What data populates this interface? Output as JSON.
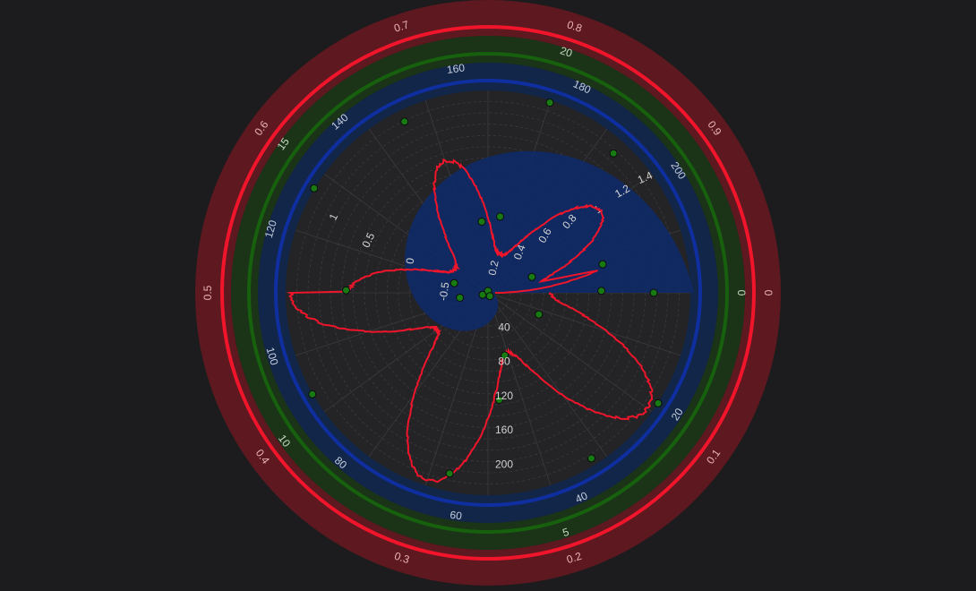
{
  "chart_data": {
    "type": "polar",
    "colors": {
      "background": "#1c1c1e",
      "plot_background": "#242427",
      "ring_outer": "#5e1820",
      "ring_middle": "#1b3418",
      "ring_inner": "#112648",
      "ring_red_line": "#f0152a",
      "ring_green_line": "#16600e",
      "ring_blue_line": "#0f2fa0",
      "spiral_fill": "#0f2a6a",
      "series_line": "#f0152a",
      "scatter": "#177a12",
      "grid": "#3b3b3f"
    },
    "outer_axis": {
      "ticks": [
        {
          "value": 0,
          "label": "0"
        },
        {
          "value": 0.1,
          "label": "0.1"
        },
        {
          "value": 0.2,
          "label": "0.2"
        },
        {
          "value": 0.3,
          "label": "0.3"
        },
        {
          "value": 0.4,
          "label": "0.4"
        },
        {
          "value": 0.5,
          "label": "0.5"
        },
        {
          "value": 0.6,
          "label": "0.6"
        },
        {
          "value": 0.7,
          "label": "0.7"
        },
        {
          "value": 0.8,
          "label": "0.8"
        },
        {
          "value": 0.9,
          "label": "0.9"
        }
      ],
      "range": [
        0,
        1
      ]
    },
    "middle_axis": {
      "ticks": [
        {
          "value": 0,
          "label": "0"
        },
        {
          "value": 5,
          "label": "5"
        },
        {
          "value": 10,
          "label": "10"
        },
        {
          "value": 15,
          "label": "15"
        },
        {
          "value": 20,
          "label": "20"
        }
      ],
      "range": [
        0,
        25
      ]
    },
    "inner_axis": {
      "ticks": [
        {
          "value": 20,
          "label": "20"
        },
        {
          "value": 40,
          "label": "40"
        },
        {
          "value": 60,
          "label": "60"
        },
        {
          "value": 80,
          "label": "80"
        },
        {
          "value": 100,
          "label": "100"
        },
        {
          "value": 120,
          "label": "120"
        },
        {
          "value": 140,
          "label": "140"
        },
        {
          "value": 160,
          "label": "160"
        },
        {
          "value": 180,
          "label": "180"
        },
        {
          "value": 200,
          "label": "200"
        }
      ],
      "range": [
        0,
        220
      ]
    },
    "radial_axis": {
      "ticks": [
        "40",
        "80",
        "120",
        "160",
        "200"
      ],
      "values": [
        40,
        80,
        120,
        160,
        200
      ],
      "range": [
        0,
        220
      ]
    },
    "spiral_axis": {
      "ticks": [
        "-0.5",
        "0",
        "0.2",
        "0.4",
        "0.6",
        "0.8",
        "1",
        "1.2",
        "1.4"
      ],
      "secondary_ticks": [
        "0.5",
        "1"
      ],
      "spiral_value_range": [
        -0.7,
        1.45
      ]
    },
    "series": [
      {
        "type": "line",
        "petals": 5,
        "base_radius": 70,
        "petal_amplitude": 150,
        "inner_lobes": 3,
        "inner_lobe_radius": 110,
        "noise": 4
      },
      {
        "type": "scatter",
        "points": [
          {
            "r": 210,
            "theta": 72
          },
          {
            "r": 200,
            "theta": 116
          },
          {
            "r": 213,
            "theta": 149
          },
          {
            "r": 197,
            "theta": 48
          },
          {
            "r": 75,
            "theta": 95
          },
          {
            "r": 81,
            "theta": 81
          },
          {
            "r": 49,
            "theta": 20
          },
          {
            "r": 124,
            "theta": 14
          },
          {
            "r": 174,
            "theta": 0
          },
          {
            "r": 119,
            "theta": 1
          },
          {
            "r": 37,
            "theta": 164
          },
          {
            "r": 149,
            "theta": 179
          },
          {
            "r": 30,
            "theta": 190
          },
          {
            "r": 6,
            "theta": 200
          },
          {
            "r": 58,
            "theta": 337
          },
          {
            "r": 68,
            "theta": 285
          },
          {
            "r": 113,
            "theta": 276
          },
          {
            "r": 213,
            "theta": 327
          },
          {
            "r": 205,
            "theta": 302
          },
          {
            "r": 194,
            "theta": 258
          },
          {
            "r": 213,
            "theta": 210
          },
          {
            "r": 2,
            "theta": 90
          },
          {
            "r": 4,
            "theta": 300
          }
        ]
      }
    ],
    "grid": true
  }
}
